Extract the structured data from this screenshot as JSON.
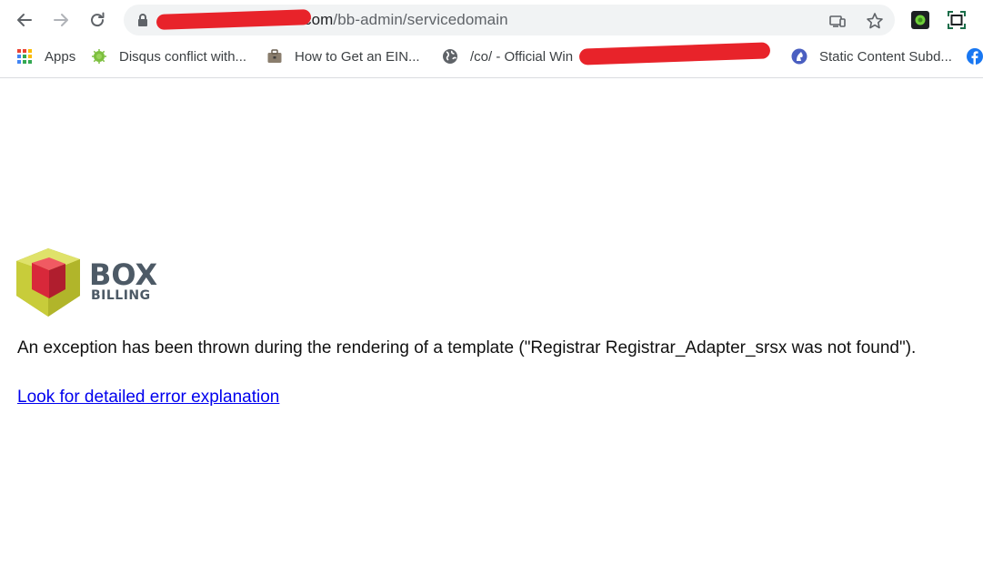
{
  "browser": {
    "address_bar": {
      "url_host_visible": "com",
      "url_path": "/bb-admin/servicedomain"
    },
    "bookmarks": [
      {
        "label": "Apps",
        "icon": "apps-grid-icon"
      },
      {
        "label": "Disqus conflict with...",
        "icon": "android-icon"
      },
      {
        "label": "How to Get an EIN...",
        "icon": "briefcase-icon"
      },
      {
        "label": "/co/ - Official Win",
        "icon": "globe-icon"
      },
      {
        "label": "Static Content Subd...",
        "icon": "horse-icon"
      }
    ]
  },
  "page": {
    "logo": {
      "line1": "BOX",
      "line2": "BILLING"
    },
    "error_message": "An exception has been thrown during the rendering of a template (\"Registrar Registrar_Adapter_srsx was not found\").",
    "error_link": "Look for detailed error explanation"
  },
  "colors": {
    "link": "#0000ee",
    "redaction": "#e8232a",
    "logo_cube_yellow": "#c8cc3a",
    "logo_cube_red": "#d8283a",
    "logo_text": "#4d5a66"
  }
}
